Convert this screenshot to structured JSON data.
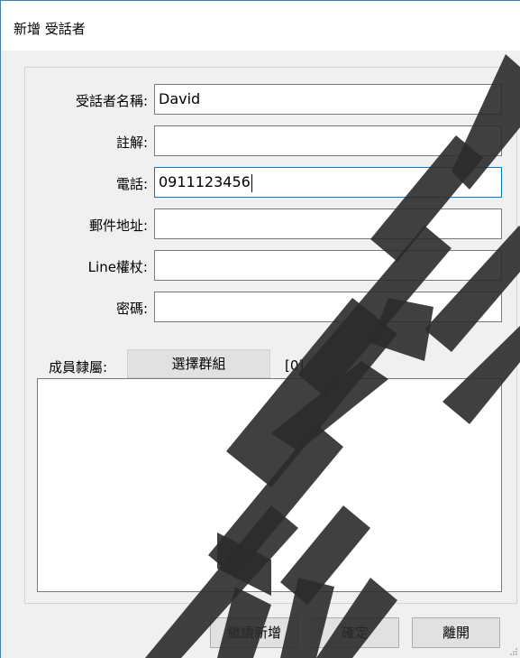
{
  "window": {
    "title": "新增 受話者"
  },
  "form": {
    "name_label": "受話者名稱:",
    "name_value": "David",
    "note_label": "註解:",
    "note_value": "",
    "phone_label": "電話:",
    "phone_value": "0911123456",
    "email_label": "郵件地址:",
    "email_value": "",
    "line_label": "Line權杖:",
    "line_value": "",
    "password_label": "密碼:",
    "password_value": ""
  },
  "members": {
    "label": "成員隸屬:",
    "select_group_label": "選擇群組",
    "count": "[0]",
    "items": []
  },
  "footer": {
    "continue_add_label": "繼續新增",
    "confirm_label": "確定",
    "leave_label": "離開"
  },
  "colors": {
    "focus_border": "#0078d7",
    "window_border": "#3a7fc4",
    "watermark": "#2b2b2b"
  }
}
